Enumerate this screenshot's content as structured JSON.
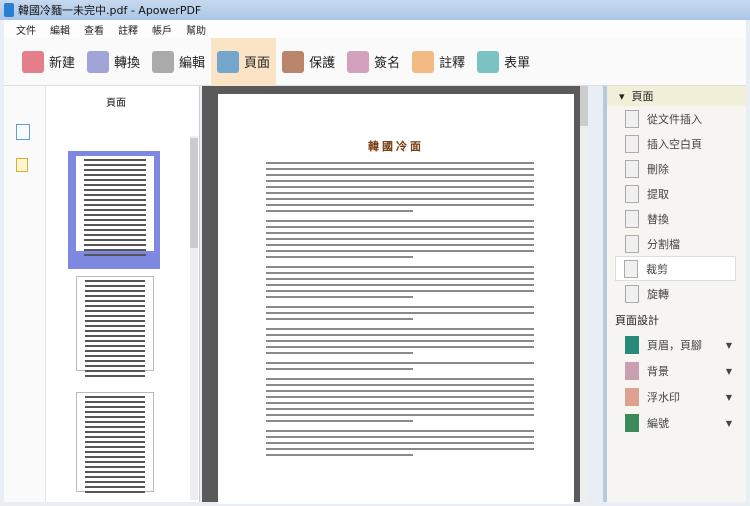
{
  "window": {
    "title": "韓國冷麵一未完中.pdf - ApowerPDF"
  },
  "menu": [
    "文件",
    "編輯",
    "查看",
    "註釋",
    "帳戶",
    "幫助"
  ],
  "toolbar": [
    {
      "label": "新建",
      "color": "#d9495a"
    },
    {
      "label": "轉換",
      "color": "#7a7fc8"
    },
    {
      "label": "編輯",
      "color": "#888"
    },
    {
      "label": "頁面",
      "color": "#3a8bd0",
      "active": true
    },
    {
      "label": "保護",
      "color": "#a0522d"
    },
    {
      "label": "簽名",
      "color": "#c07aa0"
    },
    {
      "label": "註釋",
      "color": "#f0a050"
    },
    {
      "label": "表單",
      "color": "#4aa"
    }
  ],
  "left_panel": {
    "title": "頁面"
  },
  "document": {
    "heading": "韓國冷面"
  },
  "right_panel": {
    "section1": "頁面",
    "items": [
      "從文件插入",
      "插入空白頁",
      "刪除",
      "提取",
      "替換",
      "分割檔",
      "裁剪",
      "旋轉"
    ],
    "section2": "頁面設計",
    "design_items": [
      "頁眉，頁腳",
      "背景",
      "浮水印",
      "編號"
    ]
  }
}
